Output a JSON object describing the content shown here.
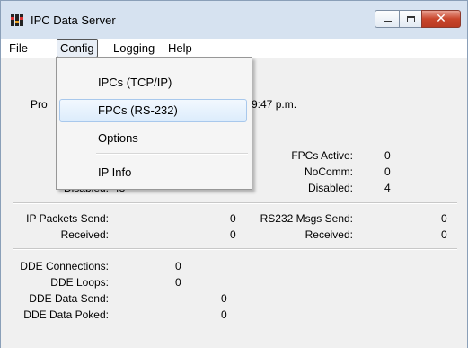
{
  "window": {
    "title": "IPC Data Server",
    "icon": "app-bars-icon"
  },
  "menubar": {
    "items": [
      "File",
      "Config",
      "Logging",
      "Help"
    ]
  },
  "config_menu": {
    "items": [
      "IPCs (TCP/IP)",
      "FPCs (RS-232)",
      "Options",
      "IP Info"
    ],
    "highlighted": "FPCs (RS-232)"
  },
  "status": {
    "pro_label_partial": "Pro",
    "time_partial": "9:47 p.m.",
    "fpcs_active_label": "FPCs Active:",
    "fpcs_active_value": "0",
    "nocomm_label": "NoComm:",
    "nocomm_value": "0",
    "ipcs_disabled_label": "Disabled:",
    "ipcs_disabled_value": "48",
    "fpcs_disabled_label": "Disabled:",
    "fpcs_disabled_value": "4"
  },
  "packets": {
    "ip_send_label": "IP Packets Send:",
    "ip_send_value": "0",
    "ip_received_label": "Received:",
    "ip_received_value": "0",
    "rs232_send_label": "RS232 Msgs Send:",
    "rs232_send_value": "0",
    "rs232_received_label": "Received:",
    "rs232_received_value": "0"
  },
  "dde": {
    "connections_label": "DDE Connections:",
    "connections_value": "0",
    "loops_label": "DDE Loops:",
    "loops_value": "0",
    "data_send_label": "DDE Data Send:",
    "data_send_value": "0",
    "data_poked_label": "DDE Data Poked:",
    "data_poked_value": "0"
  }
}
